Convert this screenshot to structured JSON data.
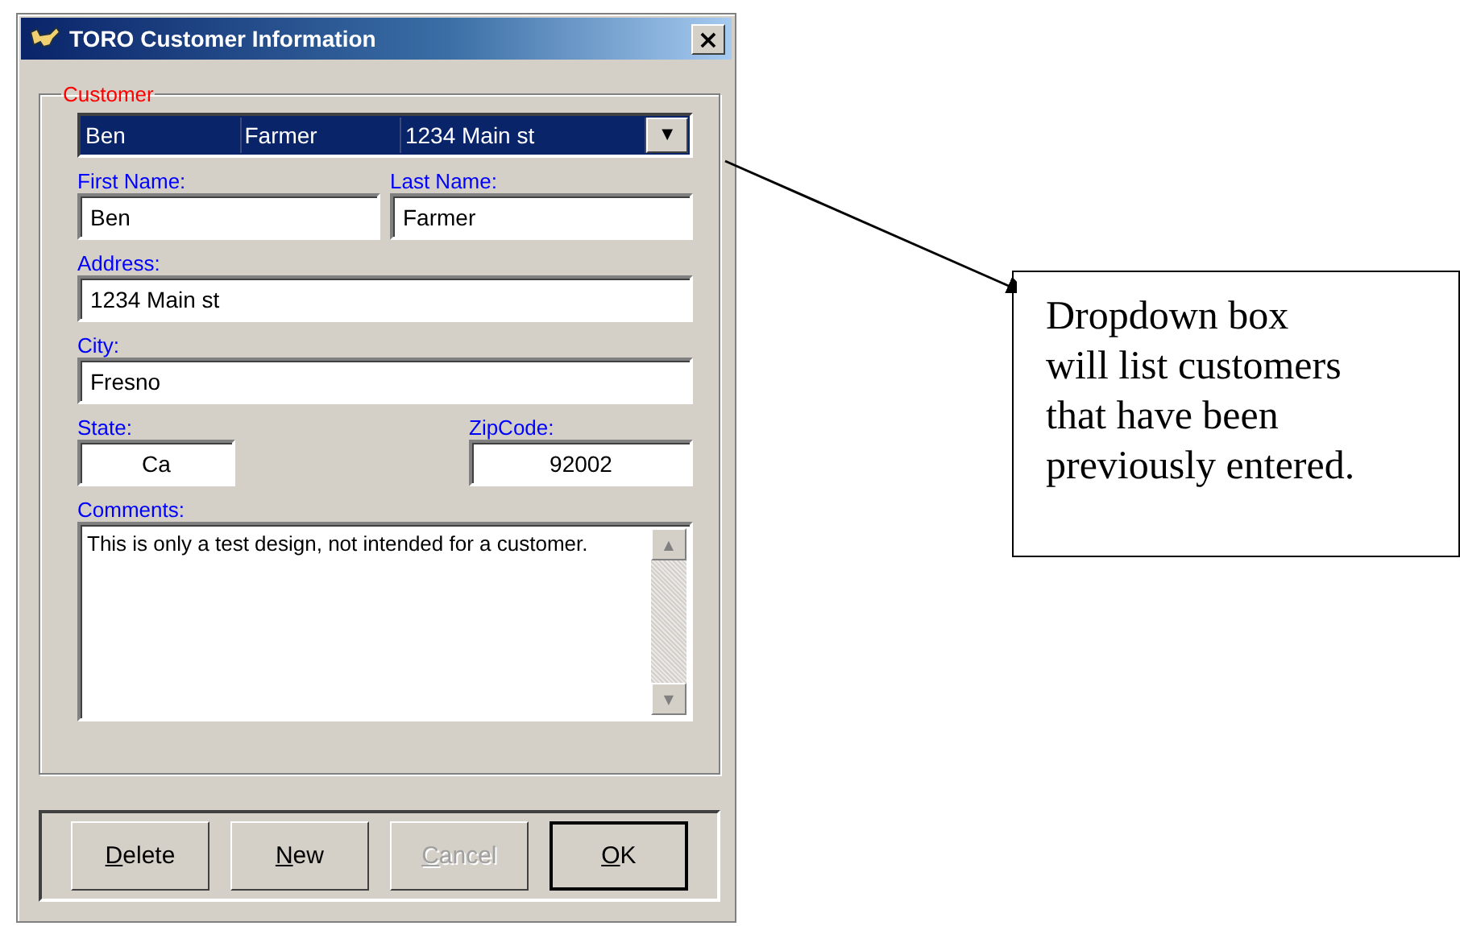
{
  "window": {
    "title": "TORO Customer Information",
    "close": "×"
  },
  "group": {
    "title": "Customer"
  },
  "combo": {
    "columns": [
      "Ben",
      "Farmer",
      "1234 Main st"
    ],
    "arrow": "▼"
  },
  "rows": [
    {
      "fields": [
        {
          "label": "First Name:",
          "value": "Ben",
          "centered": false
        },
        {
          "label": "Last Name:",
          "value": "Farmer",
          "centered": false
        }
      ]
    },
    {
      "fields": [
        {
          "label": "Address:",
          "value": "1234 Main st",
          "centered": false
        }
      ]
    },
    {
      "fields": [
        {
          "label": "City:",
          "value": "Fresno",
          "centered": false
        }
      ]
    },
    {
      "fields": [
        {
          "label": "State:",
          "value": "Ca",
          "centered": true
        },
        {
          "label": "ZipCode:",
          "value": "92002",
          "centered": true
        }
      ]
    }
  ],
  "comments": {
    "label": "Comments:",
    "value": "This is only a test design, not intended for a customer.",
    "scroll_up": "▲",
    "scroll_down": "▼"
  },
  "buttons": [
    {
      "label": "Delete",
      "disabled": false,
      "default": false
    },
    {
      "label": "New",
      "disabled": false,
      "default": false
    },
    {
      "label": "Cancel",
      "disabled": true,
      "default": false
    },
    {
      "label": "OK",
      "disabled": false,
      "default": true
    }
  ],
  "callout": {
    "lines": [
      "Dropdown box",
      "will list customers",
      "that have been",
      "previously entered."
    ]
  }
}
